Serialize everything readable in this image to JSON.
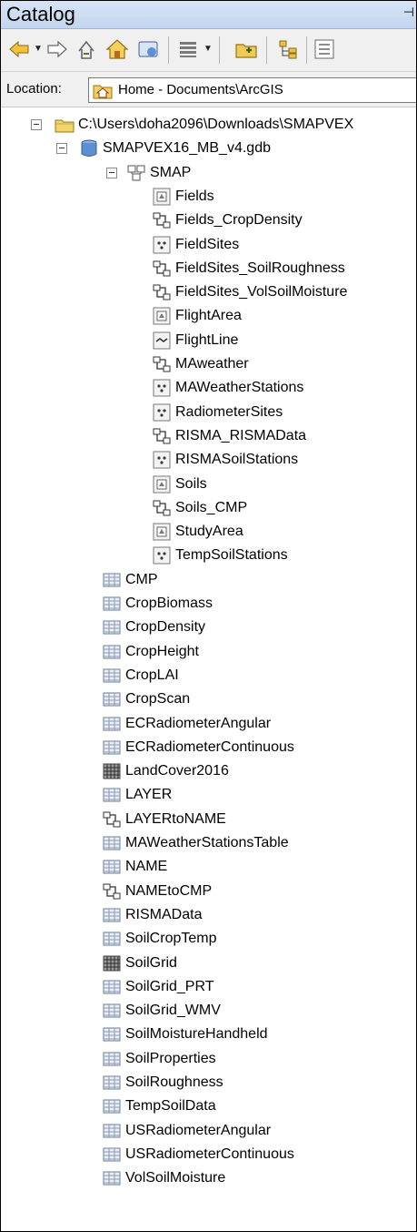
{
  "window": {
    "title": "Catalog"
  },
  "toolbar": {
    "buttons": [
      {
        "name": "back-icon"
      },
      {
        "name": "forward-icon"
      },
      {
        "name": "up-one-level-icon"
      },
      {
        "name": "home-icon"
      },
      {
        "name": "toggle-contents-icon"
      },
      {
        "name": "view-options-icon"
      },
      {
        "name": "connect-folder-icon"
      },
      {
        "name": "tree-options-icon"
      },
      {
        "name": "details-icon"
      }
    ]
  },
  "location": {
    "label": "Location:",
    "value": "Home - Documents\\ArcGIS"
  },
  "tree": {
    "root_folder": "C:\\Users\\doha2096\\Downloads\\SMAPVEX",
    "gdb": "SMAPVEX16_MB_v4.gdb",
    "dataset": "SMAP",
    "dataset_items": [
      {
        "label": "Fields",
        "icon": "polygon"
      },
      {
        "label": "Fields_CropDensity",
        "icon": "relationship"
      },
      {
        "label": "FieldSites",
        "icon": "point"
      },
      {
        "label": "FieldSites_SoilRoughness",
        "icon": "relationship"
      },
      {
        "label": "FieldSites_VolSoilMoisture",
        "icon": "relationship"
      },
      {
        "label": "FlightArea",
        "icon": "polygon"
      },
      {
        "label": "FlightLine",
        "icon": "line"
      },
      {
        "label": "MAweather",
        "icon": "relationship"
      },
      {
        "label": "MAWeatherStations",
        "icon": "point"
      },
      {
        "label": "RadiometerSites",
        "icon": "point"
      },
      {
        "label": "RISMA_RISMAData",
        "icon": "relationship"
      },
      {
        "label": "RISMASoilStations",
        "icon": "point"
      },
      {
        "label": "Soils",
        "icon": "polygon"
      },
      {
        "label": "Soils_CMP",
        "icon": "relationship"
      },
      {
        "label": "StudyArea",
        "icon": "polygon"
      },
      {
        "label": "TempSoilStations",
        "icon": "point"
      }
    ],
    "gdb_items": [
      {
        "label": "CMP",
        "icon": "table"
      },
      {
        "label": "CropBiomass",
        "icon": "table"
      },
      {
        "label": "CropDensity",
        "icon": "table"
      },
      {
        "label": "CropHeight",
        "icon": "table"
      },
      {
        "label": "CropLAI",
        "icon": "table"
      },
      {
        "label": "CropScan",
        "icon": "table"
      },
      {
        "label": "ECRadiometerAngular",
        "icon": "table"
      },
      {
        "label": "ECRadiometerContinuous",
        "icon": "table"
      },
      {
        "label": "LandCover2016",
        "icon": "raster"
      },
      {
        "label": "LAYER",
        "icon": "table"
      },
      {
        "label": "LAYERtoNAME",
        "icon": "relationship"
      },
      {
        "label": "MAWeatherStationsTable",
        "icon": "table"
      },
      {
        "label": "NAME",
        "icon": "table"
      },
      {
        "label": "NAMEtoCMP",
        "icon": "relationship"
      },
      {
        "label": "RISMAData",
        "icon": "table"
      },
      {
        "label": "SoilCropTemp",
        "icon": "table"
      },
      {
        "label": "SoilGrid",
        "icon": "raster"
      },
      {
        "label": "SoilGrid_PRT",
        "icon": "table"
      },
      {
        "label": "SoilGrid_WMV",
        "icon": "table"
      },
      {
        "label": "SoilMoistureHandheld",
        "icon": "table"
      },
      {
        "label": "SoilProperties",
        "icon": "table"
      },
      {
        "label": "SoilRoughness",
        "icon": "table"
      },
      {
        "label": "TempSoilData",
        "icon": "table"
      },
      {
        "label": "USRadiometerAngular",
        "icon": "table"
      },
      {
        "label": "USRadiometerContinuous",
        "icon": "table"
      },
      {
        "label": "VolSoilMoisture",
        "icon": "table"
      }
    ]
  }
}
